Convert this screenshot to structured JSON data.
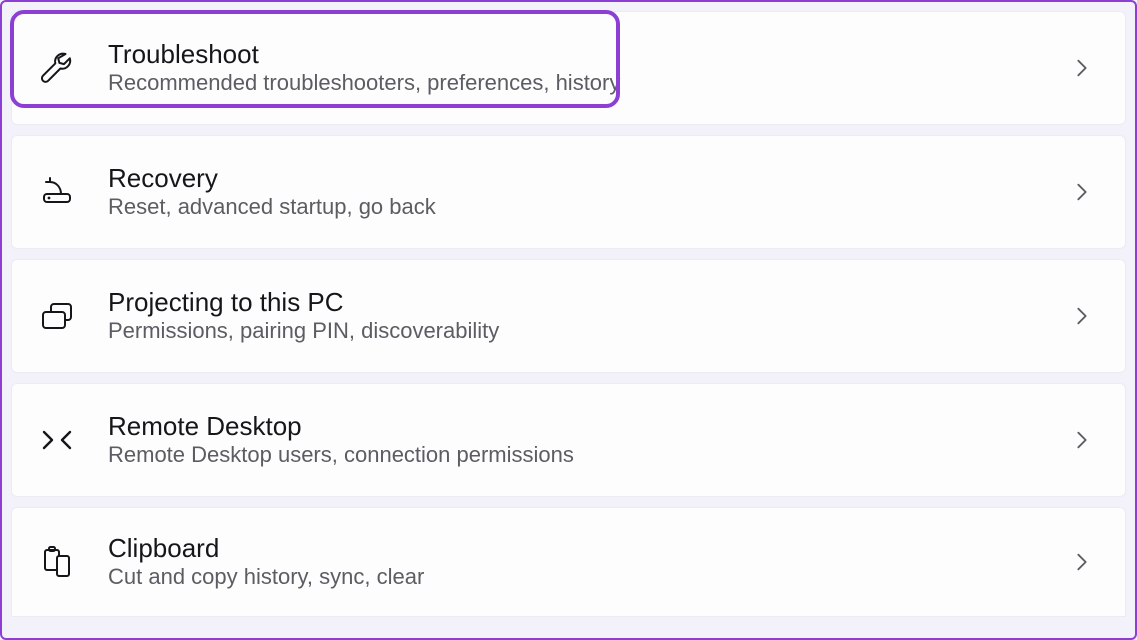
{
  "items": [
    {
      "key": "troubleshoot",
      "title": "Troubleshoot",
      "subtitle": "Recommended troubleshooters, preferences, history",
      "icon": "wrench-icon",
      "highlighted": true
    },
    {
      "key": "recovery",
      "title": "Recovery",
      "subtitle": "Reset, advanced startup, go back",
      "icon": "recovery-icon",
      "highlighted": false
    },
    {
      "key": "projecting",
      "title": "Projecting to this PC",
      "subtitle": "Permissions, pairing PIN, discoverability",
      "icon": "projecting-icon",
      "highlighted": false
    },
    {
      "key": "remote-desktop",
      "title": "Remote Desktop",
      "subtitle": "Remote Desktop users, connection permissions",
      "icon": "remote-desktop-icon",
      "highlighted": false
    },
    {
      "key": "clipboard",
      "title": "Clipboard",
      "subtitle": "Cut and copy history, sync, clear",
      "icon": "clipboard-icon",
      "highlighted": false
    }
  ]
}
